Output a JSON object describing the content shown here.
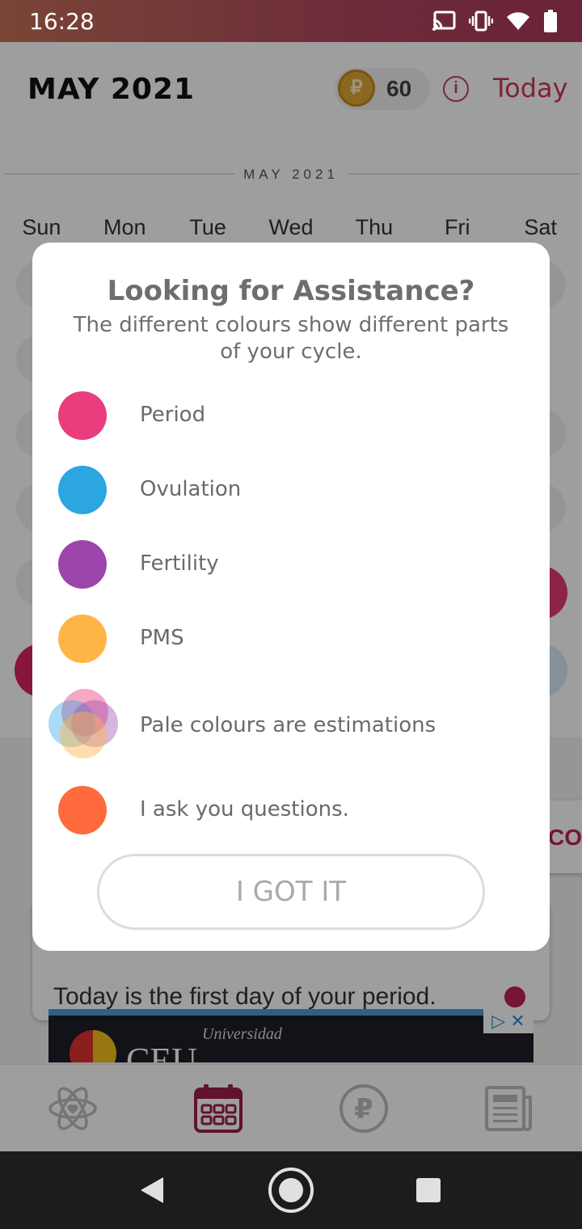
{
  "status_bar": {
    "time": "16:28",
    "icons": [
      "cast-icon",
      "vibrate-icon",
      "wifi-icon",
      "battery-icon"
    ]
  },
  "header": {
    "title": "MAY 2021",
    "coins": "60",
    "coin_symbol": "₽",
    "info_symbol": "i",
    "today_label": "Today"
  },
  "calendar": {
    "month_label": "MAY 2021",
    "weekdays": [
      "Sun",
      "Mon",
      "Tue",
      "Wed",
      "Thu",
      "Fri",
      "Sat"
    ]
  },
  "card": {
    "text": "Today is the first day of your period."
  },
  "side_tab": {
    "text": "CON"
  },
  "ad": {
    "text": "Universidad",
    "brand": "CEU",
    "close": "▷ ✕"
  },
  "bottom_nav": {
    "items": [
      "atom-icon",
      "calendar-icon",
      "coin-icon",
      "news-icon"
    ],
    "active_color": "#9c1d4d",
    "inactive_color": "#bdbdbd"
  },
  "dialog": {
    "title": "Looking for Assistance?",
    "subtitle": "The different colours show different parts of your cycle.",
    "legend": [
      {
        "label": "Period",
        "color": "#ea3d7d"
      },
      {
        "label": "Ovulation",
        "color": "#2ba6e0"
      },
      {
        "label": "Fertility",
        "color": "#9c46ac"
      },
      {
        "label": "PMS",
        "color": "#ffb546"
      },
      {
        "label": "Pale colours are estimations",
        "color": "pale"
      },
      {
        "label": "I ask you questions.",
        "color": "#ff6b3d"
      }
    ],
    "button_label": "I GOT IT"
  },
  "system_nav": {
    "items": [
      "back-icon",
      "home-icon",
      "recents-icon"
    ]
  }
}
